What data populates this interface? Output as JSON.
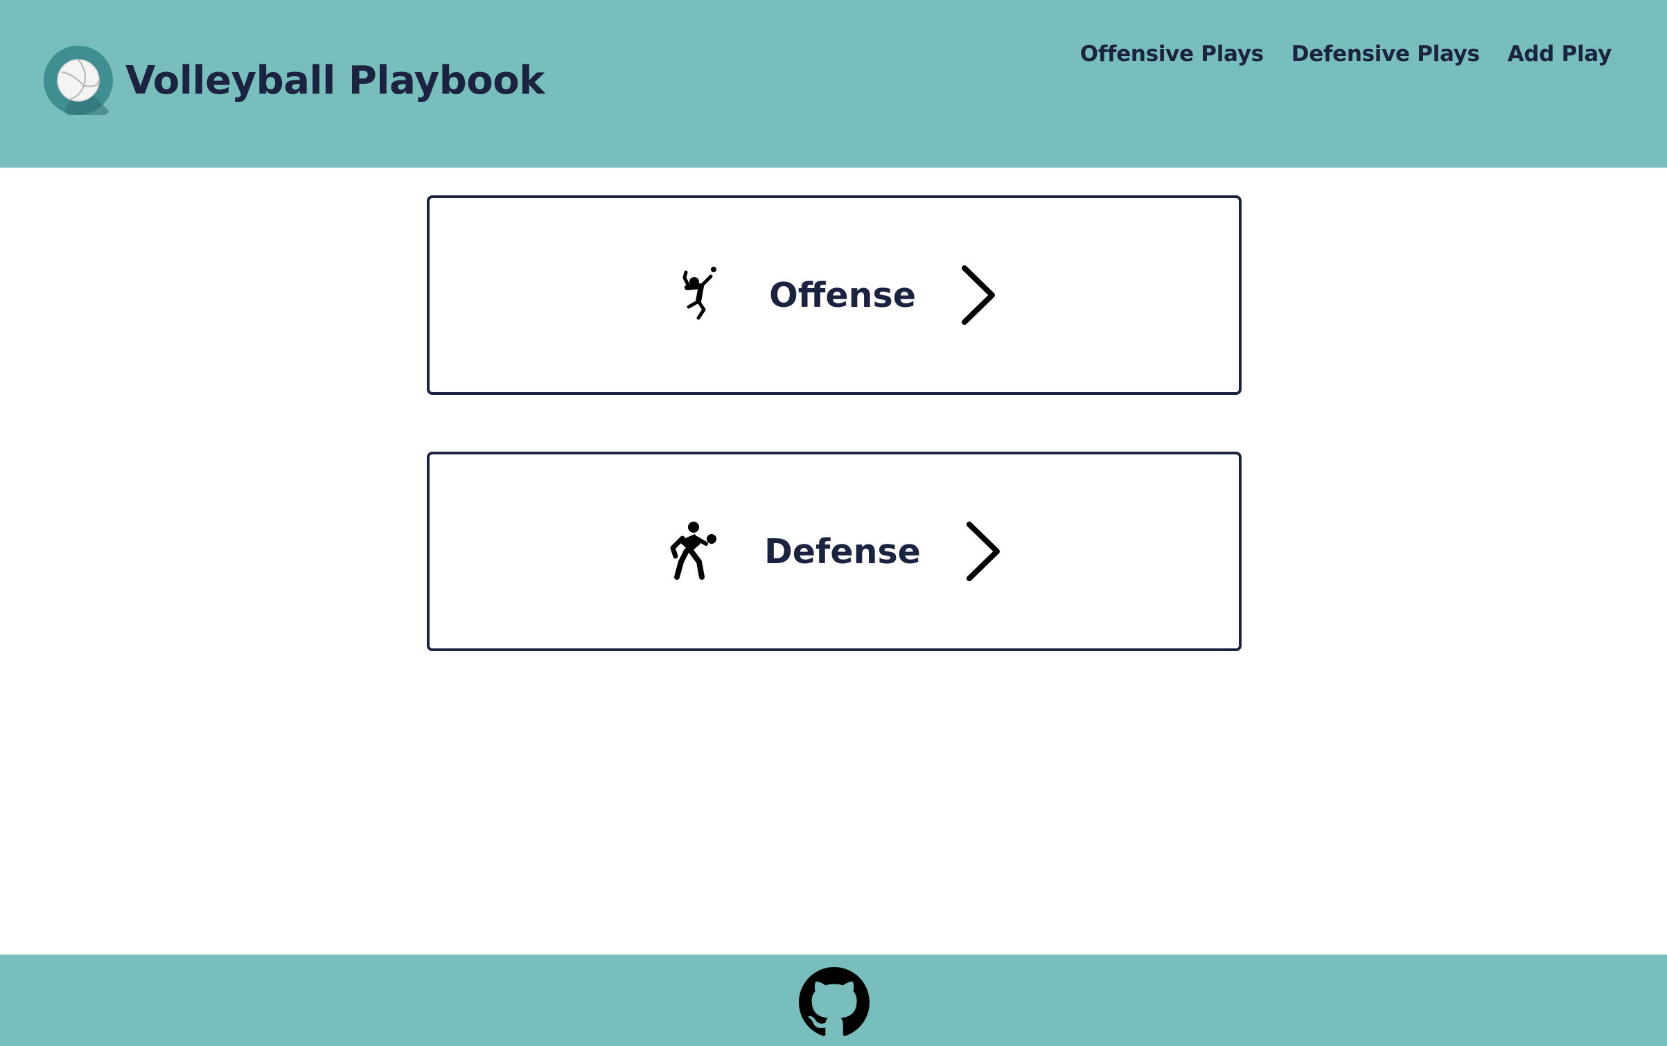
{
  "header": {
    "logo_icon": "volleyball-icon",
    "title": "Volleyball Playbook",
    "nav": [
      {
        "label": "Offensive Plays"
      },
      {
        "label": "Defensive Plays"
      },
      {
        "label": "Add Play"
      }
    ]
  },
  "main": {
    "cards": [
      {
        "label": "Offense",
        "icon": "volleyball-spike-player-icon",
        "arrow_icon": "chevron-right-icon"
      },
      {
        "label": "Defense",
        "icon": "volleyball-dig-player-icon",
        "arrow_icon": "chevron-right-icon"
      }
    ]
  },
  "footer": {
    "icon": "github-icon"
  },
  "colors": {
    "header_bg": "#78bebd",
    "footer_bg": "#78bebd",
    "text": "#1b2340",
    "card_border": "#1b2340",
    "page_bg": "#ffffff"
  }
}
